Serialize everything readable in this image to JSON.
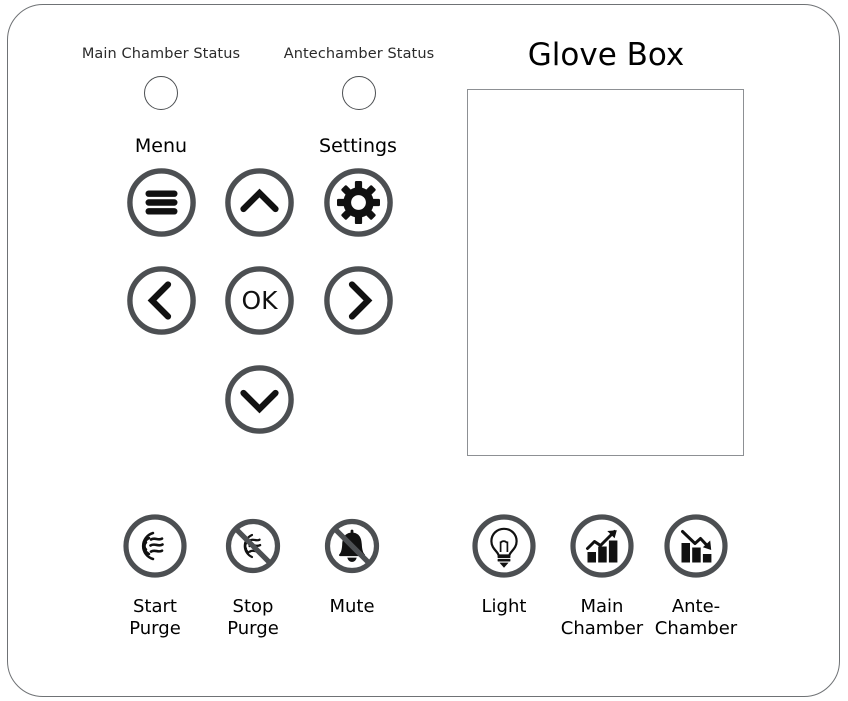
{
  "panel": {
    "title": "Glove Box",
    "frame_color": "#6f7275",
    "ring_color": "#4c4f52",
    "icon_color": "#111111",
    "display": {
      "name": "main-display-screen",
      "content": "",
      "border_color": "#8d9094",
      "background": "#ffffff"
    }
  },
  "status_indicators": [
    {
      "label": "Main Chamber Status",
      "icon": "status-lamp-icon",
      "state": "off"
    },
    {
      "label": "Antechamber Status",
      "icon": "status-lamp-icon",
      "state": "off"
    }
  ],
  "keypad": {
    "labels": {
      "menu": "Menu",
      "settings": "Settings"
    },
    "buttons": [
      {
        "name": "menu-button",
        "icon": "hamburger-menu-icon",
        "text": ""
      },
      {
        "name": "up-button",
        "icon": "chevron-up-icon",
        "text": ""
      },
      {
        "name": "settings-button",
        "icon": "gear-icon",
        "text": ""
      },
      {
        "name": "left-button",
        "icon": "chevron-left-icon",
        "text": ""
      },
      {
        "name": "ok-button",
        "icon": "ok-text-icon",
        "text": "OK"
      },
      {
        "name": "right-button",
        "icon": "chevron-right-icon",
        "text": ""
      },
      {
        "name": "down-button",
        "icon": "chevron-down-icon",
        "text": ""
      }
    ]
  },
  "actions_left": [
    {
      "name": "start-purge-button",
      "icon": "airflow-icon",
      "label": "Start\nPurge"
    },
    {
      "name": "stop-purge-button",
      "icon": "airflow-slashed-icon",
      "label": "Stop\nPurge"
    },
    {
      "name": "mute-button",
      "icon": "bell-slashed-icon",
      "label": "Mute"
    }
  ],
  "actions_right": [
    {
      "name": "light-button",
      "icon": "lightbulb-icon",
      "label": "Light"
    },
    {
      "name": "main-chamber-button",
      "icon": "chart-trend-up-icon",
      "label": "Main\nChamber"
    },
    {
      "name": "ante-chamber-button",
      "icon": "chart-trend-down-icon",
      "label": "Ante-\nChamber"
    }
  ]
}
